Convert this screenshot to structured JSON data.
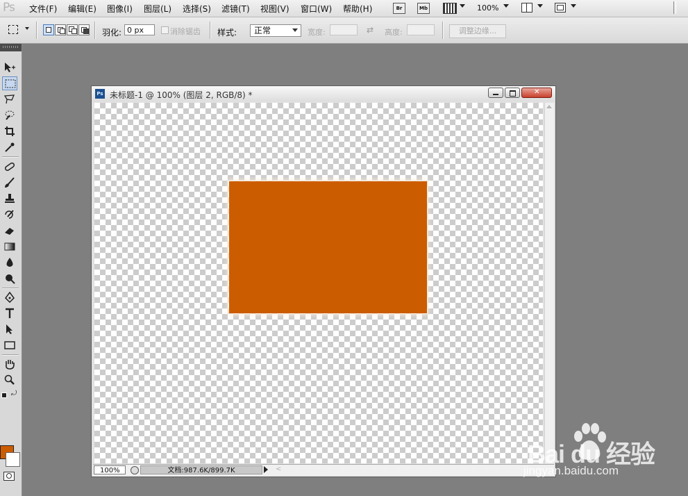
{
  "app": {
    "logo": "Ps"
  },
  "menu": {
    "items": [
      "文件(F)",
      "编辑(E)",
      "图像(I)",
      "图层(L)",
      "选择(S)",
      "滤镜(T)",
      "视图(V)",
      "窗口(W)",
      "帮助(H)"
    ],
    "br_label": "Br",
    "mb_label": "Mb",
    "zoom": "100%"
  },
  "options": {
    "feather_label": "羽化:",
    "feather_value": "0 px",
    "antialias_label": "消除锯齿",
    "style_label": "样式:",
    "style_value": "正常",
    "width_label": "宽度:",
    "height_label": "高度:",
    "refine_edge": "调整边缘..."
  },
  "toolbox": {
    "foreground_color": "#cc5c00",
    "background_color": "#ffffff"
  },
  "document": {
    "icon_label": "Ps",
    "title": "未标题-1 @ 100% (图层 2, RGB/8) *",
    "status_zoom": "100%",
    "status_info": "文档:987.6K/899.7K",
    "shape_color": "#cc5c00"
  },
  "watermark": {
    "logo_text": "Bai  du 经验",
    "url": "jingyan.baidu.com"
  }
}
